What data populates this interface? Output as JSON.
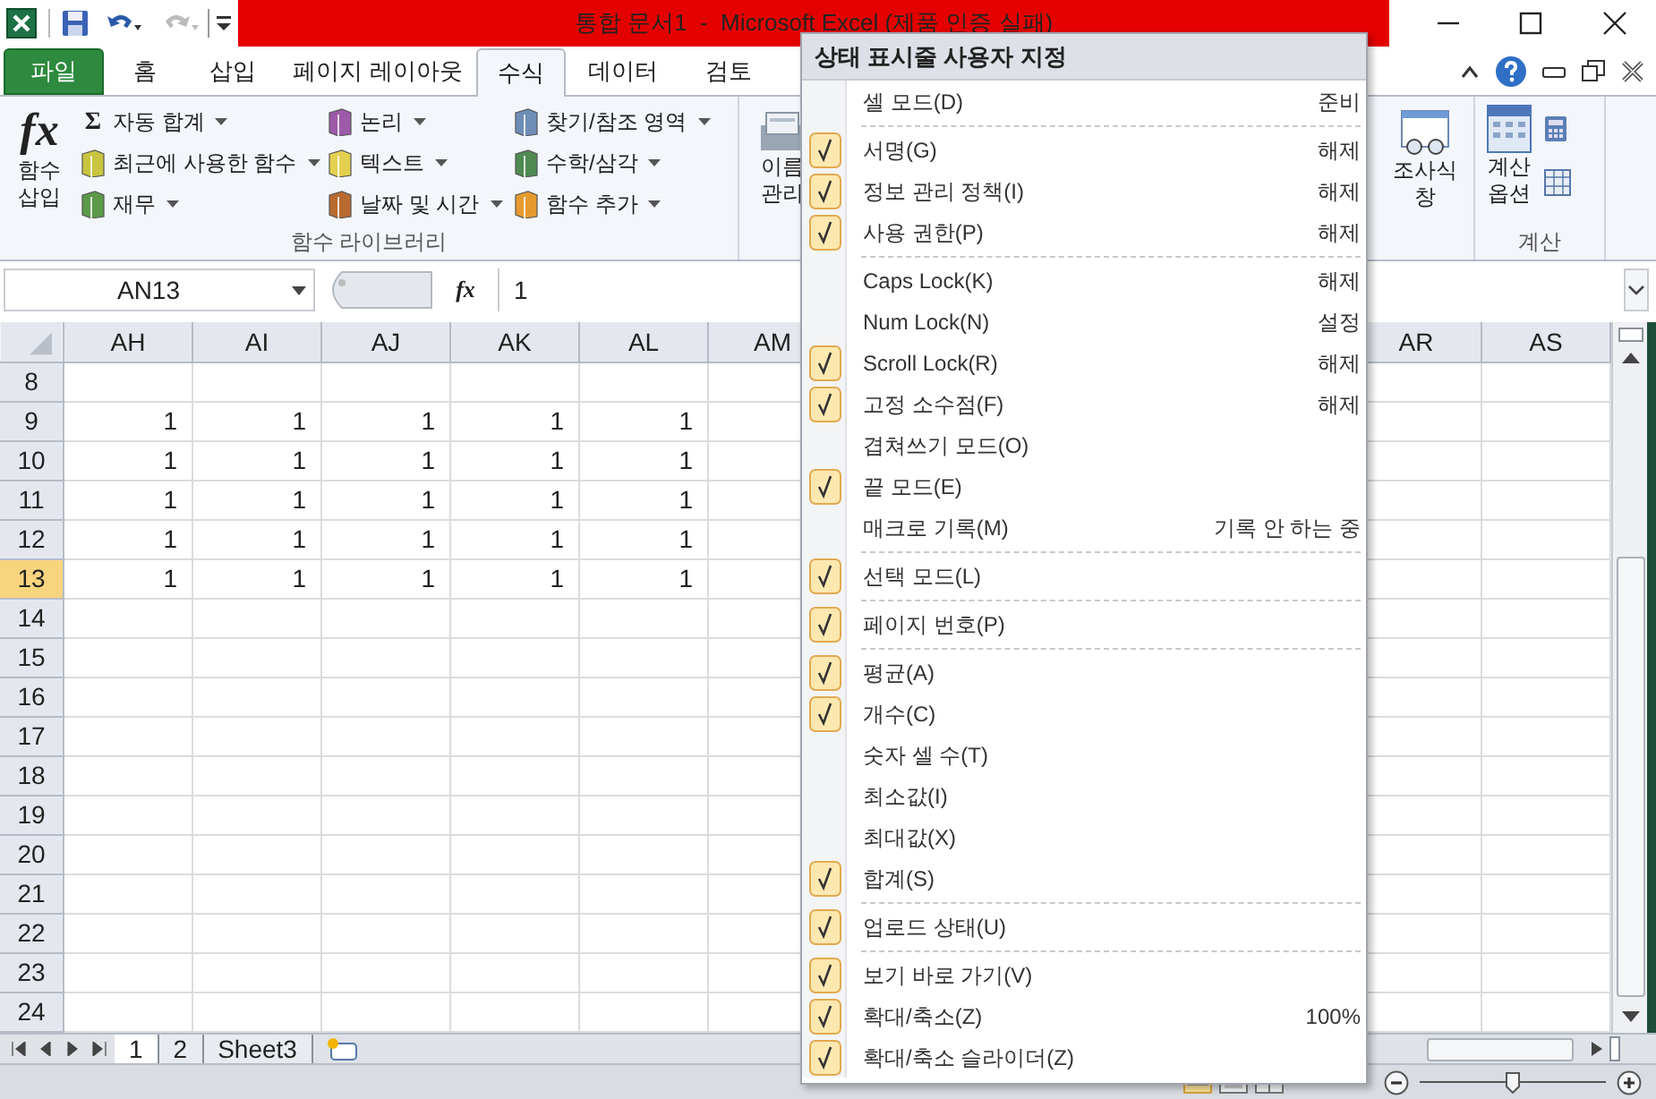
{
  "window": {
    "title": "통합 문서1  -  Microsoft Excel (제품 인증 실패)"
  },
  "ribbon_tabs": [
    {
      "label": "파일",
      "kind": "file",
      "selected": false
    },
    {
      "label": "홈",
      "kind": "tab",
      "selected": false
    },
    {
      "label": "삽입",
      "kind": "tab",
      "selected": false
    },
    {
      "label": "페이지 레이아웃",
      "kind": "tab",
      "selected": false
    },
    {
      "label": "수식",
      "kind": "tab",
      "selected": true
    },
    {
      "label": "데이터",
      "kind": "tab",
      "selected": false
    },
    {
      "label": "검토",
      "kind": "tab",
      "selected": false
    }
  ],
  "function_library": {
    "insert_function": {
      "glyph": "fx",
      "lines": [
        "함수",
        "삽입"
      ]
    },
    "columns": [
      [
        {
          "label": "자동 합계",
          "glyph": "Σ"
        },
        {
          "label": "최근에 사용한 함수"
        },
        {
          "label": "재무"
        }
      ],
      [
        {
          "label": "논리"
        },
        {
          "label": "텍스트"
        },
        {
          "label": "날짜 및 시간"
        }
      ],
      [
        {
          "label": "찾기/참조 영역"
        },
        {
          "label": "수학/삼각"
        },
        {
          "label": "함수 추가"
        }
      ]
    ],
    "group_label": "함수 라이브러리"
  },
  "name_manager": {
    "lines": [
      "이름",
      "관리"
    ]
  },
  "watch_window": {
    "lines": [
      "조사식",
      "창"
    ]
  },
  "calculation": {
    "options_lines": [
      "계산",
      "옵션"
    ],
    "group_label": "계산"
  },
  "formula_bar": {
    "name_box": "AN13",
    "fx_label": "fx",
    "value": "1"
  },
  "sheet": {
    "columns": [
      {
        "label": "AH"
      },
      {
        "label": "AI"
      },
      {
        "label": "AJ"
      },
      {
        "label": "AK"
      },
      {
        "label": "AL"
      },
      {
        "label": "AM"
      },
      {
        "label": "AR"
      },
      {
        "label": "AS"
      }
    ],
    "rows": [
      {
        "header": "8",
        "selected": false
      },
      {
        "header": "9",
        "selected": false,
        "values": [
          "1",
          "1",
          "1",
          "1",
          "1"
        ]
      },
      {
        "header": "10",
        "selected": false,
        "values": [
          "1",
          "1",
          "1",
          "1",
          "1"
        ]
      },
      {
        "header": "11",
        "selected": false,
        "values": [
          "1",
          "1",
          "1",
          "1",
          "1"
        ]
      },
      {
        "header": "12",
        "selected": false,
        "values": [
          "1",
          "1",
          "1",
          "1",
          "1"
        ]
      },
      {
        "header": "13",
        "selected": true,
        "values": [
          "1",
          "1",
          "1",
          "1",
          "1"
        ]
      },
      {
        "header": "14",
        "selected": false
      },
      {
        "header": "15",
        "selected": false
      },
      {
        "header": "16",
        "selected": false
      },
      {
        "header": "17",
        "selected": false
      },
      {
        "header": "18",
        "selected": false
      },
      {
        "header": "19",
        "selected": false
      },
      {
        "header": "20",
        "selected": false
      },
      {
        "header": "21",
        "selected": false
      },
      {
        "header": "22",
        "selected": false
      },
      {
        "header": "23",
        "selected": false
      },
      {
        "header": "24",
        "selected": false
      }
    ]
  },
  "sheet_tabs": [
    {
      "label": "1",
      "selected": true
    },
    {
      "label": "2",
      "selected": false
    },
    {
      "label": "Sheet3",
      "selected": false
    }
  ],
  "status_bar": {
    "zoom_slider": {
      "level": 0.5
    }
  },
  "context_menu": {
    "title": "상태 표시줄 사용자 지정",
    "sections": [
      [
        {
          "label": "셀 모드(D)",
          "value": "준비",
          "checked": false
        }
      ],
      [
        {
          "label": "서명(G)",
          "value": "해제",
          "checked": true
        },
        {
          "label": "정보 관리 정책(I)",
          "value": "해제",
          "checked": true
        },
        {
          "label": "사용 권한(P)",
          "value": "해제",
          "checked": true
        }
      ],
      [
        {
          "label": "Caps Lock(K)",
          "value": "해제",
          "checked": false
        },
        {
          "label": "Num Lock(N)",
          "value": "설정",
          "checked": false
        },
        {
          "label": "Scroll Lock(R)",
          "value": "해제",
          "checked": true
        },
        {
          "label": "고정 소수점(F)",
          "value": "해제",
          "checked": true
        },
        {
          "label": "겹쳐쓰기 모드(O)",
          "checked": false
        },
        {
          "label": "끝 모드(E)",
          "checked": true
        },
        {
          "label": "매크로 기록(M)",
          "value": "기록 안 하는 중",
          "checked": false
        }
      ],
      [
        {
          "label": "선택 모드(L)",
          "checked": true
        }
      ],
      [
        {
          "label": "페이지 번호(P)",
          "checked": true
        }
      ],
      [
        {
          "label": "평균(A)",
          "checked": true
        },
        {
          "label": "개수(C)",
          "checked": true
        },
        {
          "label": "숫자 셀 수(T)",
          "checked": false
        },
        {
          "label": "최소값(I)",
          "checked": false
        },
        {
          "label": "최대값(X)",
          "checked": false
        },
        {
          "label": "합계(S)",
          "checked": true
        }
      ],
      [
        {
          "label": "업로드 상태(U)",
          "checked": true
        }
      ],
      [
        {
          "label": "보기 바로 가기(V)",
          "checked": true
        },
        {
          "label": "확대/축소(Z)",
          "value": "100%",
          "checked": true
        },
        {
          "label": "확대/축소 슬라이더(Z)",
          "checked": true
        }
      ]
    ]
  }
}
